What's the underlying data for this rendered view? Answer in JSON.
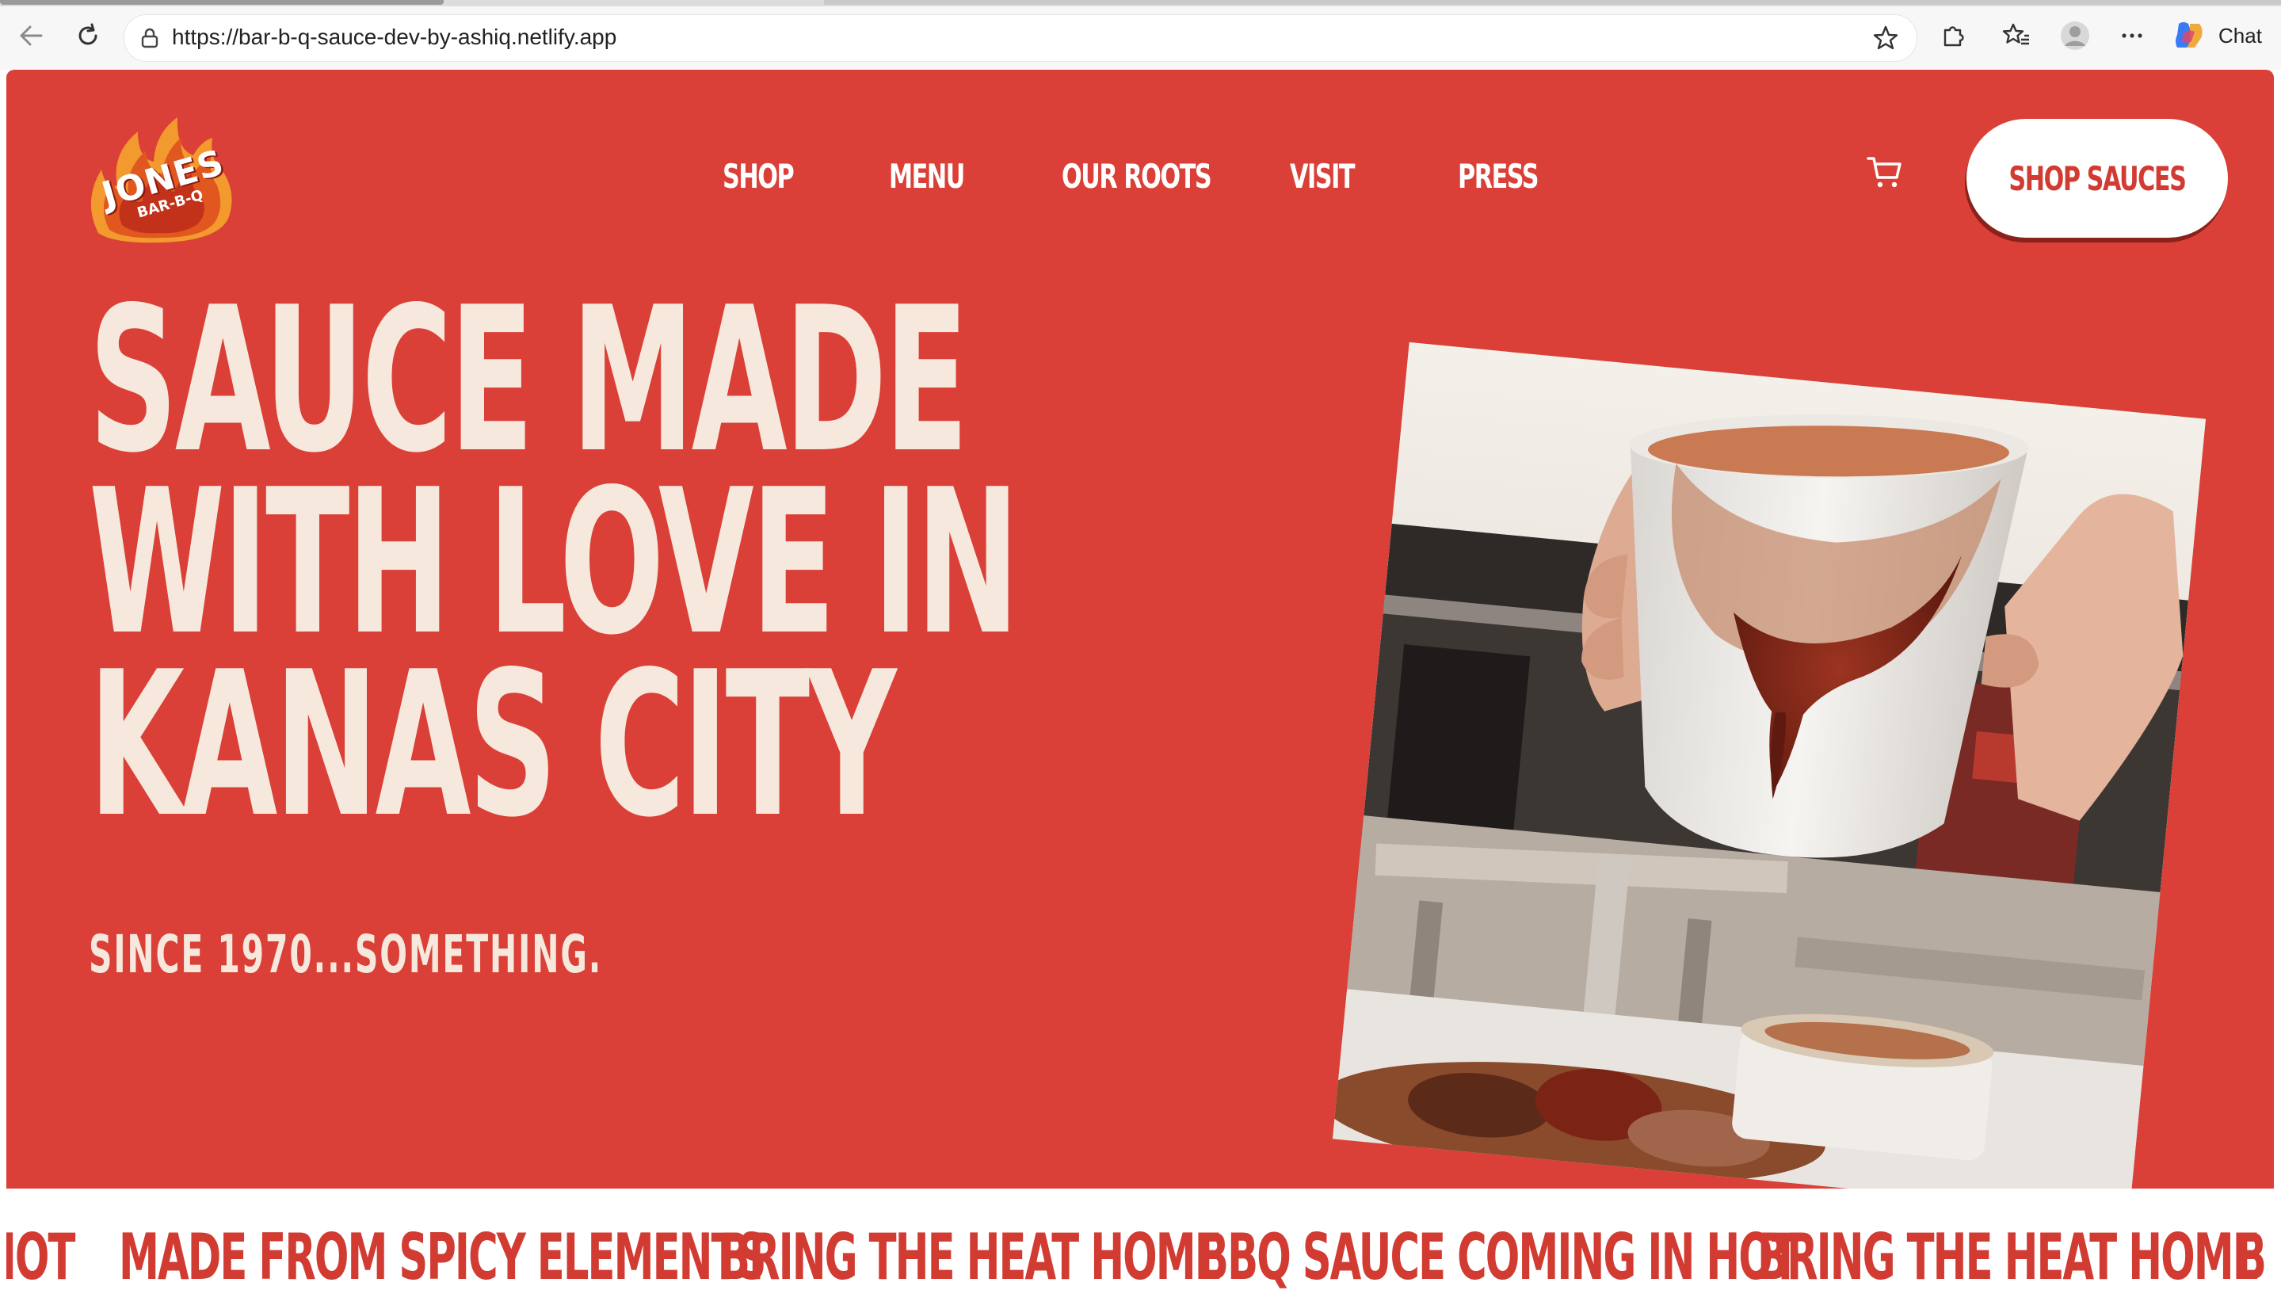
{
  "browser": {
    "url": "https://bar-b-q-sauce-dev-by-ashiq.netlify.app",
    "chat_label": "Chat"
  },
  "site": {
    "logo_text_main": "JONES",
    "logo_text_sub": "BAR-B-Q",
    "nav": [
      "SHOP",
      "MENU",
      "OUR ROOTS",
      "VISIT",
      "PRESS"
    ],
    "cta_label": "SHOP SAUCES",
    "headline_lines": [
      "SAUCE MADE",
      "WITH LOVE IN",
      "KANAS CITY"
    ],
    "tagline": "SINCE 1970...SOMETHING.",
    "marquee": [
      "HOT",
      "MADE FROM SPICY ELEMENTS",
      "BRING THE HEAT HOME",
      "BBQ SAUCE COMING IN HOT",
      "BRING THE HEAT HOME",
      "B"
    ]
  },
  "colors": {
    "hero_bg": "#da4037",
    "cream": "#f6e8dc",
    "accent_red": "#d13b31",
    "button_shadow": "#8a211a"
  }
}
